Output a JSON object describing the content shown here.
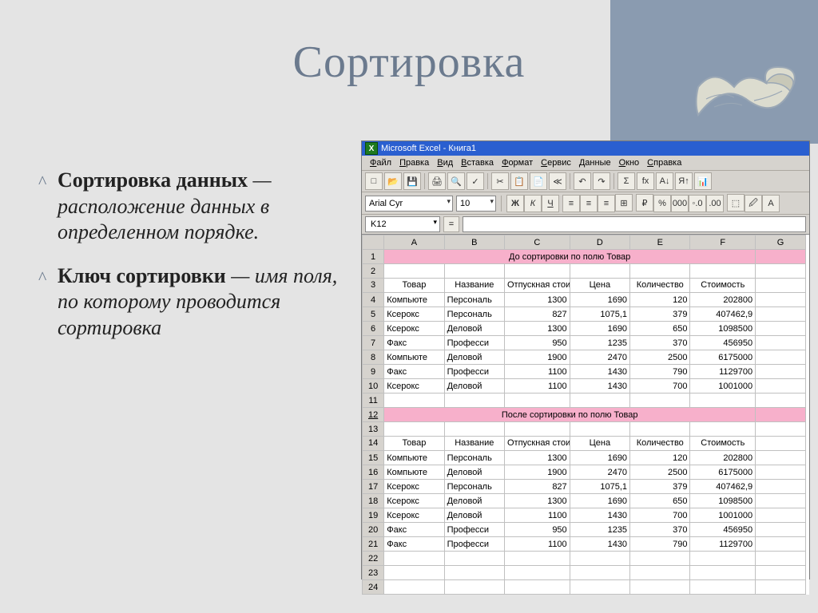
{
  "slide": {
    "title": "Сортировка",
    "bullets": [
      {
        "bold": "Сортировка данных",
        "rest_italic": " — расположение данных в определенном порядке."
      },
      {
        "bold": "Ключ сортировки",
        "rest_italic": " — имя поля, по которому проводится сортировка"
      }
    ]
  },
  "excel": {
    "titlebar": "Microsoft Excel - Книга1",
    "menus": [
      "Файл",
      "Правка",
      "Вид",
      "Вставка",
      "Формат",
      "Сервис",
      "Данные",
      "Окно",
      "Справка"
    ],
    "toolbar_icons": [
      "□",
      "📂",
      "💾",
      "",
      "🖨",
      "🔍",
      "✓",
      "",
      "✂",
      "📋",
      "📄",
      "≪",
      "",
      "↶",
      "↷",
      "",
      "Σ",
      "fx",
      "A↓",
      "Я↑",
      "📊"
    ],
    "font_name": "Arial Cyr",
    "font_size": "10",
    "format_buttons": [
      "Ж",
      "К",
      "Ч",
      "",
      "≡",
      "≡",
      "≡",
      "⊞",
      "",
      "₽",
      "%",
      "000",
      "◦.0",
      ".00",
      "",
      "⬚",
      "🖉",
      "A"
    ],
    "name_box": "K12",
    "columns": [
      "",
      "A",
      "B",
      "C",
      "D",
      "E",
      "F",
      "G"
    ],
    "title_row_1": "До сортировки по полю Товар",
    "title_row_2": "После сортировки по полю Товар",
    "headers": [
      "Товар",
      "Название",
      "Отпускная стоимость",
      "Цена",
      "Количество",
      "Стоимость"
    ],
    "before": [
      [
        "Компьюте",
        "Персональ",
        "1300",
        "1690",
        "120",
        "202800"
      ],
      [
        "Ксерокс",
        "Персональ",
        "827",
        "1075,1",
        "379",
        "407462,9"
      ],
      [
        "Ксерокс",
        "Деловой",
        "1300",
        "1690",
        "650",
        "1098500"
      ],
      [
        "Факс",
        "Професси",
        "950",
        "1235",
        "370",
        "456950"
      ],
      [
        "Компьюте",
        "Деловой",
        "1900",
        "2470",
        "2500",
        "6175000"
      ],
      [
        "Факс",
        "Професси",
        "1100",
        "1430",
        "790",
        "1129700"
      ],
      [
        "Ксерокс",
        "Деловой",
        "1100",
        "1430",
        "700",
        "1001000"
      ]
    ],
    "after": [
      [
        "Компьюте",
        "Персональ",
        "1300",
        "1690",
        "120",
        "202800"
      ],
      [
        "Компьюте",
        "Деловой",
        "1900",
        "2470",
        "2500",
        "6175000"
      ],
      [
        "Ксерокс",
        "Персональ",
        "827",
        "1075,1",
        "379",
        "407462,9"
      ],
      [
        "Ксерокс",
        "Деловой",
        "1300",
        "1690",
        "650",
        "1098500"
      ],
      [
        "Ксерокс",
        "Деловой",
        "1100",
        "1430",
        "700",
        "1001000"
      ],
      [
        "Факс",
        "Професси",
        "950",
        "1235",
        "370",
        "456950"
      ],
      [
        "Факс",
        "Професси",
        "1100",
        "1430",
        "790",
        "1129700"
      ]
    ]
  },
  "chart_data": {
    "type": "table",
    "note": "Two data tables shown in an Excel screenshot: before and after sorting by field 'Товар'.",
    "headers": [
      "Товар",
      "Название",
      "Отпускная стоимость",
      "Цена",
      "Количество",
      "Стоимость"
    ],
    "before_sort": [
      {
        "Товар": "Компьютер",
        "Название": "Персональный",
        "Отпускная стоимость": 1300,
        "Цена": 1690,
        "Количество": 120,
        "Стоимость": 202800
      },
      {
        "Товар": "Ксерокс",
        "Название": "Персональный",
        "Отпускная стоимость": 827,
        "Цена": 1075.1,
        "Количество": 379,
        "Стоимость": 407462.9
      },
      {
        "Товар": "Ксерокс",
        "Название": "Деловой",
        "Отпускная стоимость": 1300,
        "Цена": 1690,
        "Количество": 650,
        "Стоимость": 1098500
      },
      {
        "Товар": "Факс",
        "Название": "Профессиональный",
        "Отпускная стоимость": 950,
        "Цена": 1235,
        "Количество": 370,
        "Стоимость": 456950
      },
      {
        "Товар": "Компьютер",
        "Название": "Деловой",
        "Отпускная стоимость": 1900,
        "Цена": 2470,
        "Количество": 2500,
        "Стоимость": 6175000
      },
      {
        "Товар": "Факс",
        "Название": "Профессиональный",
        "Отпускная стоимость": 1100,
        "Цена": 1430,
        "Количество": 790,
        "Стоимость": 1129700
      },
      {
        "Товар": "Ксерокс",
        "Название": "Деловой",
        "Отпускная стоимость": 1100,
        "Цена": 1430,
        "Количество": 700,
        "Стоимость": 1001000
      }
    ],
    "after_sort": [
      {
        "Товар": "Компьютер",
        "Название": "Персональный",
        "Отпускная стоимость": 1300,
        "Цена": 1690,
        "Количество": 120,
        "Стоимость": 202800
      },
      {
        "Товар": "Компьютер",
        "Название": "Деловой",
        "Отпускная стоимость": 1900,
        "Цена": 2470,
        "Количество": 2500,
        "Стоимость": 6175000
      },
      {
        "Товар": "Ксерокс",
        "Название": "Персональный",
        "Отпускная стоимость": 827,
        "Цена": 1075.1,
        "Количество": 379,
        "Стоимость": 407462.9
      },
      {
        "Товар": "Ксерокс",
        "Название": "Деловой",
        "Отпускная стоимость": 1300,
        "Цена": 1690,
        "Количество": 650,
        "Стоимость": 1098500
      },
      {
        "Товар": "Ксерокс",
        "Название": "Деловой",
        "Отпускная стоимость": 1100,
        "Цена": 1430,
        "Количество": 700,
        "Стоимость": 1001000
      },
      {
        "Товар": "Факс",
        "Название": "Профессиональный",
        "Отпускная стоимость": 950,
        "Цена": 1235,
        "Количество": 370,
        "Стоимость": 456950
      },
      {
        "Товар": "Факс",
        "Название": "Профессиональный",
        "Отпускная стоимость": 1100,
        "Цена": 1430,
        "Количество": 790,
        "Стоимость": 1129700
      }
    ]
  }
}
